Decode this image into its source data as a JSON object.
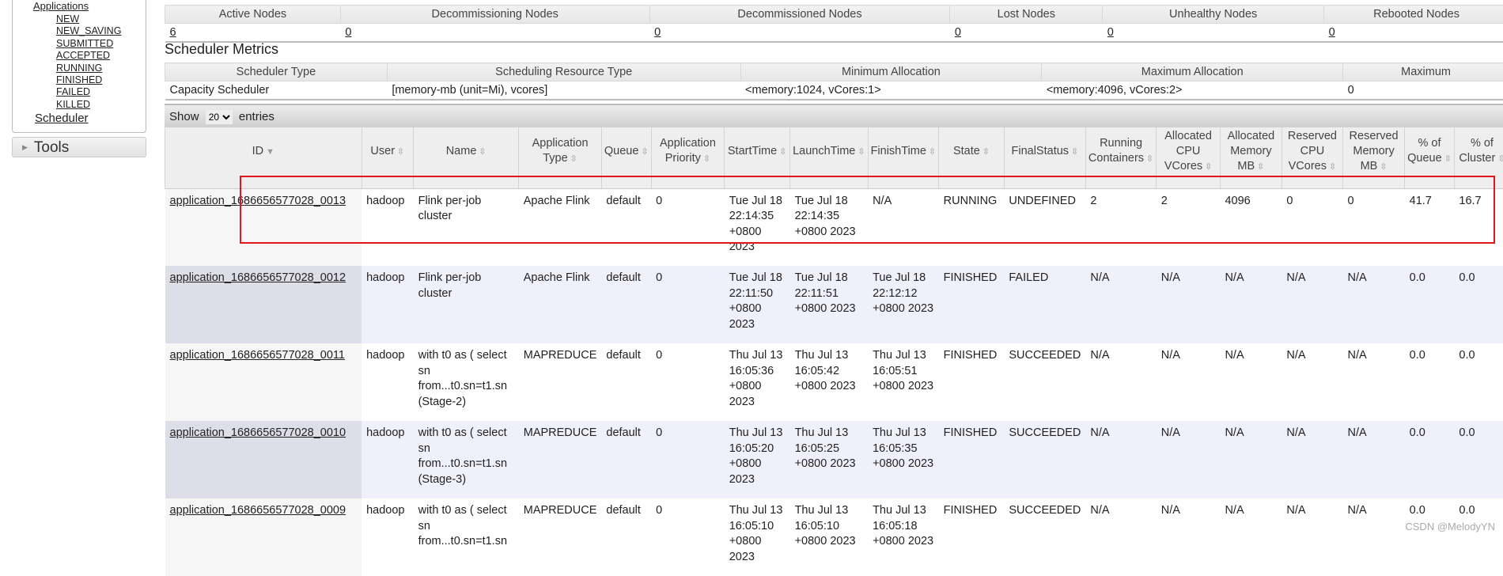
{
  "sidebar": {
    "applications_label": "Applications",
    "states": [
      "NEW",
      "NEW_SAVING",
      "SUBMITTED",
      "ACCEPTED",
      "RUNNING",
      "FINISHED",
      "FAILED",
      "KILLED"
    ],
    "scheduler": "Scheduler",
    "tools": "Tools"
  },
  "nodes": {
    "headers": [
      "Active Nodes",
      "Decommissioning Nodes",
      "Decommissioned Nodes",
      "Lost Nodes",
      "Unhealthy Nodes",
      "Rebooted Nodes"
    ],
    "values": [
      "6",
      "0",
      "0",
      "0",
      "0",
      "0"
    ]
  },
  "scheduler_metrics": {
    "title": "Scheduler Metrics",
    "headers": [
      "Scheduler Type",
      "Scheduling Resource Type",
      "Minimum Allocation",
      "Maximum Allocation",
      "Maximum"
    ],
    "values": [
      "Capacity Scheduler",
      "[memory-mb (unit=Mi), vcores]",
      "<memory:1024, vCores:1>",
      "<memory:4096, vCores:2>",
      "0"
    ]
  },
  "entries": {
    "show": "Show",
    "value": "20",
    "suffix": "entries"
  },
  "apps": {
    "headers": [
      "ID",
      "User",
      "Name",
      "Application Type",
      "Queue",
      "Application Priority",
      "StartTime",
      "LaunchTime",
      "FinishTime",
      "State",
      "FinalStatus",
      "Running Containers",
      "Allocated CPU VCores",
      "Allocated Memory MB",
      "Reserved CPU VCores",
      "Reserved Memory MB",
      "% of Queue",
      "% of Cluster"
    ],
    "rows": [
      [
        "application_1686656577028_0013",
        "hadoop",
        "Flink per-job cluster",
        "Apache Flink",
        "default",
        "0",
        "Tue Jul 18 22:14:35 +0800 2023",
        "Tue Jul 18 22:14:35 +0800 2023",
        "N/A",
        "RUNNING",
        "UNDEFINED",
        "2",
        "2",
        "4096",
        "0",
        "0",
        "41.7",
        "16.7"
      ],
      [
        "application_1686656577028_0012",
        "hadoop",
        "Flink per-job cluster",
        "Apache Flink",
        "default",
        "0",
        "Tue Jul 18 22:11:50 +0800 2023",
        "Tue Jul 18 22:11:51 +0800 2023",
        "Tue Jul 18 22:12:12 +0800 2023",
        "FINISHED",
        "FAILED",
        "N/A",
        "N/A",
        "N/A",
        "N/A",
        "N/A",
        "0.0",
        "0.0"
      ],
      [
        "application_1686656577028_0011",
        "hadoop",
        "with t0 as ( select sn from...t0.sn=t1.sn (Stage-2)",
        "MAPREDUCE",
        "default",
        "0",
        "Thu Jul 13 16:05:36 +0800 2023",
        "Thu Jul 13 16:05:42 +0800 2023",
        "Thu Jul 13 16:05:51 +0800 2023",
        "FINISHED",
        "SUCCEEDED",
        "N/A",
        "N/A",
        "N/A",
        "N/A",
        "N/A",
        "0.0",
        "0.0"
      ],
      [
        "application_1686656577028_0010",
        "hadoop",
        "with t0 as ( select sn from...t0.sn=t1.sn (Stage-3)",
        "MAPREDUCE",
        "default",
        "0",
        "Thu Jul 13 16:05:20 +0800 2023",
        "Thu Jul 13 16:05:25 +0800 2023",
        "Thu Jul 13 16:05:35 +0800 2023",
        "FINISHED",
        "SUCCEEDED",
        "N/A",
        "N/A",
        "N/A",
        "N/A",
        "N/A",
        "0.0",
        "0.0"
      ],
      [
        "application_1686656577028_0009",
        "hadoop",
        "with t0 as ( select sn from...t0.sn=t1.sn",
        "MAPREDUCE",
        "default",
        "0",
        "Thu Jul 13 16:05:10 +0800 2023",
        "Thu Jul 13 16:05:10 +0800 2023",
        "Thu Jul 13 16:05:18 +0800 2023",
        "FINISHED",
        "SUCCEEDED",
        "N/A",
        "N/A",
        "N/A",
        "N/A",
        "N/A",
        "0.0",
        "0.0"
      ]
    ]
  },
  "watermark": "CSDN @MelodyYN",
  "colors": {
    "highlight_box": "#e2141c",
    "even_row": "#f0f0fb"
  }
}
